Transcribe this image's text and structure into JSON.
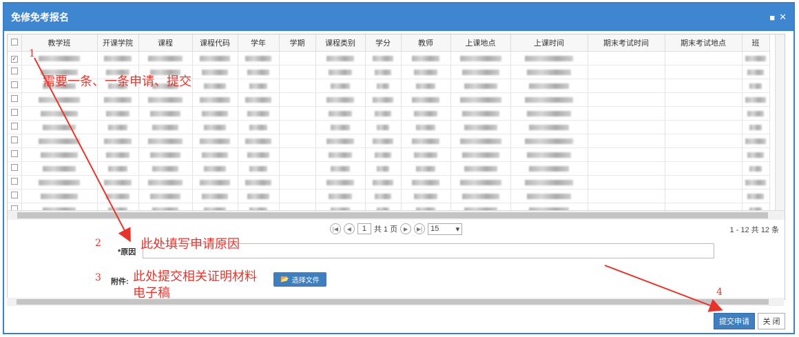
{
  "dialog": {
    "title": "免修免考报名",
    "max_icon": "■",
    "close_icon": "✕"
  },
  "table": {
    "columns": [
      "教学班",
      "开课学院",
      "课程",
      "课程代码",
      "学年",
      "学期",
      "课程类别",
      "学分",
      "教师",
      "上课地点",
      "上课时间",
      "期末考试时间",
      "期末考试地点",
      "班"
    ]
  },
  "pager": {
    "page_value": "1",
    "total_pages": "共 1 页",
    "page_size": "15",
    "summary": "1 - 12  共 12 条"
  },
  "form": {
    "reason_label": "*原因",
    "attachment_label": "附件:",
    "choose_file": "选择文件"
  },
  "annotations": {
    "n1": "1",
    "n2": "2",
    "n3": "3",
    "n4": "4",
    "text1": "需要一条、一条申请、提交",
    "text2": "此处填写申请原因",
    "text3a": "此处提交相关证明材料",
    "text3b": "电子稿"
  },
  "footer": {
    "submit": "提交申请",
    "close": "关 闭"
  },
  "colors": {
    "accent": "#3e86cf",
    "annotation": "#e8332b"
  }
}
